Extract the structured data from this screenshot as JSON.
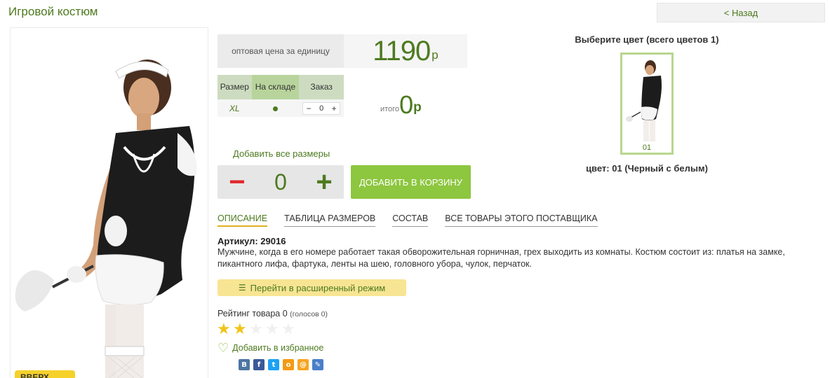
{
  "header": {
    "title": "Игровой костюм",
    "back_label": "< Назад"
  },
  "photo_badge": "ВВЕРХ",
  "price": {
    "label": "оптовая цена за единицу",
    "value": "1190",
    "currency": "р"
  },
  "sizes_table": {
    "headers": [
      "Размер",
      "На складе",
      "Заказ"
    ],
    "rows": [
      {
        "size": "XL",
        "qty": "0"
      }
    ]
  },
  "total": {
    "label": "итого",
    "value": "0",
    "currency": "р"
  },
  "add_all_label": "Добавить все размеры",
  "quantity": {
    "value": "0",
    "minus": "−",
    "plus": "+"
  },
  "cart_button_label": "ДОБАВИТЬ В КОРЗИНУ",
  "colors": {
    "title": "Выберите цвет (всего цветов 1)",
    "items": [
      {
        "code": "01"
      }
    ],
    "selected_caption": "цвет: 01 (Черный с белым)"
  },
  "tabs": [
    "ОПИСАНИЕ",
    "ТАБЛИЦА РАЗМЕРОВ",
    "СОСТАВ",
    "ВСЕ ТОВАРЫ ЭТОГО ПОСТАВЩИКА"
  ],
  "article": "Артикул: 29016",
  "description": "Мужчине, когда в его номере работает такая обворожительная горничная, грех выходить из комнаты. Костюм состоит из: платья на замке, пикантного лифа, фартука, ленты на шею, головного убора, чулок, перчаток.",
  "extended_mode_label": "Перейти в расширенный режим",
  "rating": {
    "label": "Рейтинг товара 0",
    "votes": "(голосов 0)",
    "stars_filled": 2,
    "stars_total": 5
  },
  "favorite_label": "Добавить в избранное",
  "social_icons": [
    "vk-icon",
    "facebook-icon",
    "twitter-icon",
    "odnoklassniki-icon",
    "mailru-icon",
    "livejournal-icon"
  ],
  "colors_theme": {
    "accent_green": "#4d7a1f",
    "button_green": "#8dc63f",
    "minus_red": "#e0282b",
    "star_yellow": "#f0c419"
  }
}
